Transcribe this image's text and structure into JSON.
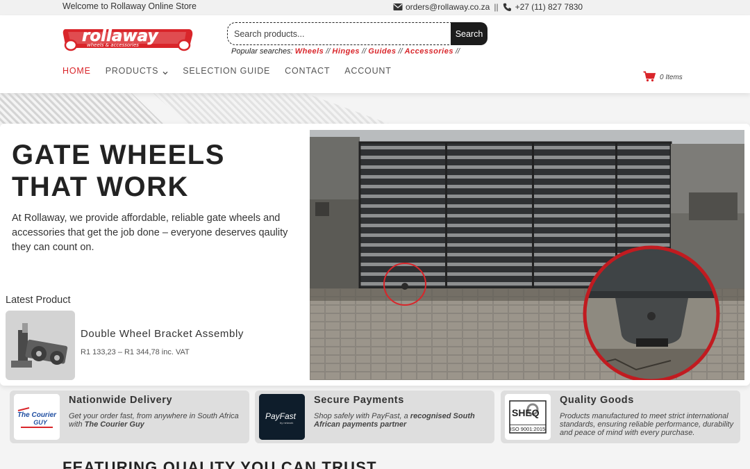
{
  "topbar": {
    "welcome": "Welcome to Rollaway Online Store",
    "email": "orders@rollaway.co.za",
    "separator": "||",
    "phone": "+27 (11) 827 7830"
  },
  "logo": {
    "name": "rollaway",
    "tagline": "wheels & accessories"
  },
  "search": {
    "placeholder": "Search products...",
    "button_label": "Search",
    "popular_label": "Popular searches:",
    "popular": [
      "Wheels",
      "Hinges",
      "Guides",
      "Accessories"
    ],
    "separator": "//"
  },
  "nav": {
    "items": [
      {
        "label": "HOME",
        "active": true
      },
      {
        "label": "PRODUCTS",
        "has_dropdown": true
      },
      {
        "label": "SELECTION GUIDE"
      },
      {
        "label": "CONTACT"
      },
      {
        "label": "ACCOUNT"
      }
    ],
    "cart_label": "0 Items",
    "accent": "#d9252a"
  },
  "hero": {
    "title_line1": "GATE WHEELS",
    "title_line2": "THAT WORK",
    "description": "At Rollaway, we provide affordable, reliable gate wheels and accessories that get the job done – everyone deserves qaulity they can count on.",
    "latest_label": "Latest Product",
    "product_name": "Double Wheel Bracket Assembly",
    "product_price": "R1 133,23 – R1 344,78 inc. VAT"
  },
  "features": [
    {
      "title": "Nationwide Delivery",
      "text_plain": "Get your order fast, from anywhere in South Africa with ",
      "text_bold": "The Courier Guy",
      "badge_line1": "The Courier",
      "badge_line2": "GUY"
    },
    {
      "title": "Secure Payments",
      "text_plain": "Shop safely with PayFast, a ",
      "text_bold": "recognised South African payments partner",
      "badge_line1": "PayFast",
      "badge_line2": "by network"
    },
    {
      "title": "Quality Goods",
      "text_plain": "Products manufactured to meet strict international standards, ensuring reliable performance, durability and peace of mind with every purchase.",
      "text_bold": "",
      "badge_line1": "SHEQ",
      "badge_line2": "ISO 9001:2015"
    }
  ],
  "featuring_heading": "FEATURING QUALITY YOU CAN TRUST"
}
